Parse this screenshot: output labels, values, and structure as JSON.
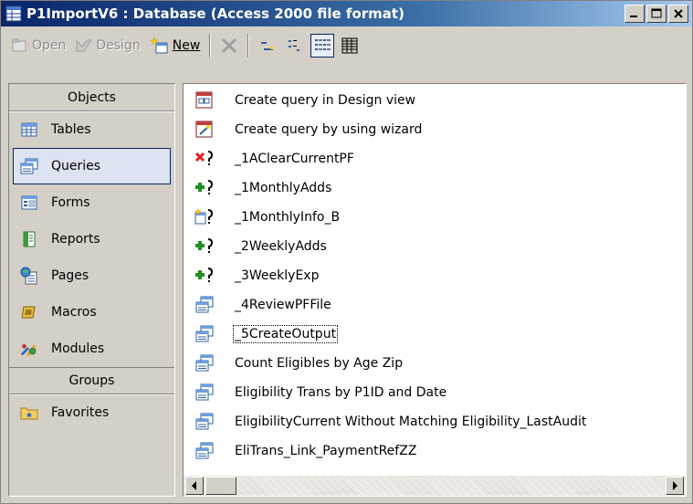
{
  "window": {
    "title": "P1ImportV6 : Database (Access 2000 file format)"
  },
  "toolbar": {
    "open_label": "Open",
    "design_label": "Design",
    "new_label": "New"
  },
  "objects_bar": {
    "objects_header": "Objects",
    "groups_header": "Groups",
    "items": [
      {
        "label": "Tables",
        "icon": "table-icon"
      },
      {
        "label": "Queries",
        "icon": "query-icon",
        "selected": true
      },
      {
        "label": "Forms",
        "icon": "form-icon"
      },
      {
        "label": "Reports",
        "icon": "report-icon"
      },
      {
        "label": "Pages",
        "icon": "page-icon"
      },
      {
        "label": "Macros",
        "icon": "macro-icon"
      },
      {
        "label": "Modules",
        "icon": "module-icon"
      }
    ],
    "groups": [
      {
        "label": "Favorites",
        "icon": "favorites-folder-icon"
      }
    ]
  },
  "query_list": [
    {
      "label": "Create query in Design view",
      "icon": "design-view-shortcut-icon"
    },
    {
      "label": "Create query by using wizard",
      "icon": "wizard-shortcut-icon"
    },
    {
      "label": "_1AClearCurrentPF",
      "icon": "delete-query-icon"
    },
    {
      "label": "_1MonthlyAdds",
      "icon": "append-query-icon"
    },
    {
      "label": "_1MonthlyInfo_B",
      "icon": "make-table-query-icon"
    },
    {
      "label": "_2WeeklyAdds",
      "icon": "append-query-icon"
    },
    {
      "label": "_3WeeklyExp",
      "icon": "append-query-icon"
    },
    {
      "label": "_4ReviewPFFile",
      "icon": "select-query-icon"
    },
    {
      "label": "_5CreateOutput",
      "icon": "select-query-icon",
      "focused": true
    },
    {
      "label": "Count Eligibles by Age Zip",
      "icon": "select-query-icon"
    },
    {
      "label": "Eligibility Trans by P1ID and Date",
      "icon": "select-query-icon"
    },
    {
      "label": "EligibilityCurrent Without Matching Eligibility_LastAudit",
      "icon": "select-query-icon"
    },
    {
      "label": "EliTrans_Link_PaymentRefZZ",
      "icon": "select-query-icon"
    }
  ],
  "colors": {
    "titlebar_start": "#0a246a",
    "titlebar_end": "#a6caf0",
    "selection_border": "#0a246a"
  }
}
